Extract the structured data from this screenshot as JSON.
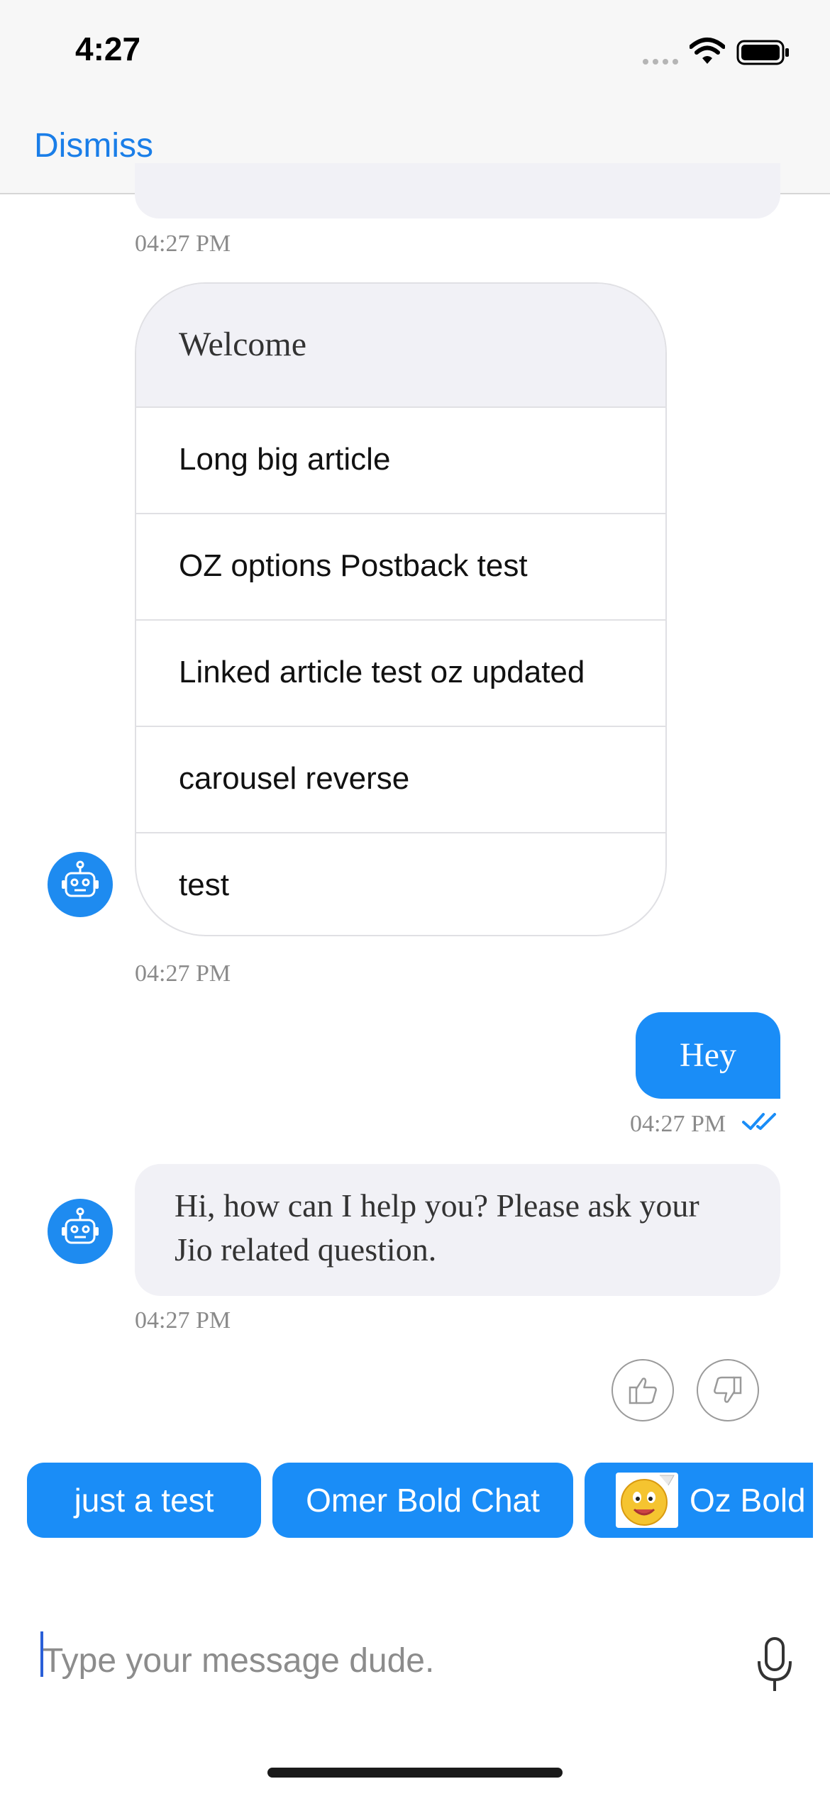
{
  "status_bar": {
    "time": "4:27"
  },
  "nav": {
    "dismiss_label": "Dismiss"
  },
  "messages": {
    "prev_timestamp": "04:27 PM",
    "menu": {
      "header": "Welcome",
      "items": [
        "Long big article",
        "OZ options Postback test",
        "Linked article test oz updated",
        "carousel reverse",
        "test"
      ],
      "timestamp": "04:27 PM"
    },
    "user_message": {
      "text": "Hey",
      "timestamp": "04:27 PM"
    },
    "bot_reply": {
      "text": "Hi, how can I help you? Please ask your Jio related question.",
      "timestamp": "04:27 PM"
    }
  },
  "quick_replies": [
    "just a test",
    "Omer Bold Chat",
    "Oz Bold"
  ],
  "composer": {
    "placeholder": "Type your message dude.",
    "mic_icon": "microphone-icon"
  },
  "colors": {
    "accent": "#1a8df7",
    "link": "#1a7ee8",
    "bubble_gray": "#f1f1f6"
  }
}
